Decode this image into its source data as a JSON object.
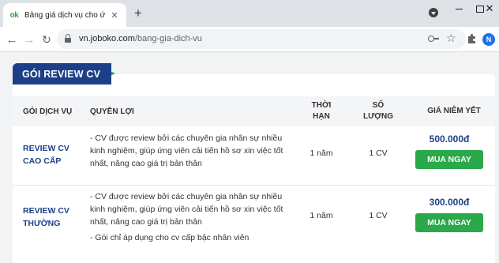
{
  "browser": {
    "tab": {
      "favicon_text": "ok",
      "title": "Bảng giá dịch vụ cho ứng viên -",
      "close": "✕"
    },
    "new_tab": "+",
    "url_host": "vn.joboko.com",
    "url_path": "/bang-gia-dich-vu",
    "profile_initial": "N",
    "star": "☆",
    "back": "←",
    "forward": "→",
    "reload": "↻",
    "close_window": "✕"
  },
  "page": {
    "section_title": "GÓI REVIEW CV",
    "table": {
      "headers": {
        "service": "GÓI DỊCH VỤ",
        "benefits": "QUYỀN LỢI",
        "duration_1": "THỜI",
        "duration_2": "HẠN",
        "quantity_1": "SỐ",
        "quantity_2": "LƯỢNG",
        "price": "GIÁ NIÊM YẾT"
      },
      "rows": [
        {
          "name_1": "REVIEW CV",
          "name_2": "CAO CẤP",
          "benefits": [
            "- CV được review bởi các chuyên gia nhân sự nhiều",
            "kinh nghiệm, giúp ứng viên cải tiến hồ sơ xin việc tốt",
            "nhất, nâng cao giá trị bản thân"
          ],
          "duration": "1 năm",
          "quantity": "1 CV",
          "price": "500.000đ",
          "button": "MUA NGAY"
        },
        {
          "name_1": "REVIEW CV",
          "name_2": "THƯỜNG",
          "benefits": [
            "- CV được review bởi các chuyên gia nhân sự nhiều",
            "kinh nghiệm, giúp ứng viên cải tiến hồ sơ xin việc tốt",
            "nhất, nâng cao giá trị bản thân",
            "- Gói chỉ áp dụng cho cv cấp bậc nhân viên"
          ],
          "duration": "1 năm",
          "quantity": "1 CV",
          "price": "300.000đ",
          "button": "MUA NGAY"
        }
      ]
    }
  },
  "colors": {
    "brand_navy": "#1d3f87",
    "brand_green": "#2aa84a"
  }
}
